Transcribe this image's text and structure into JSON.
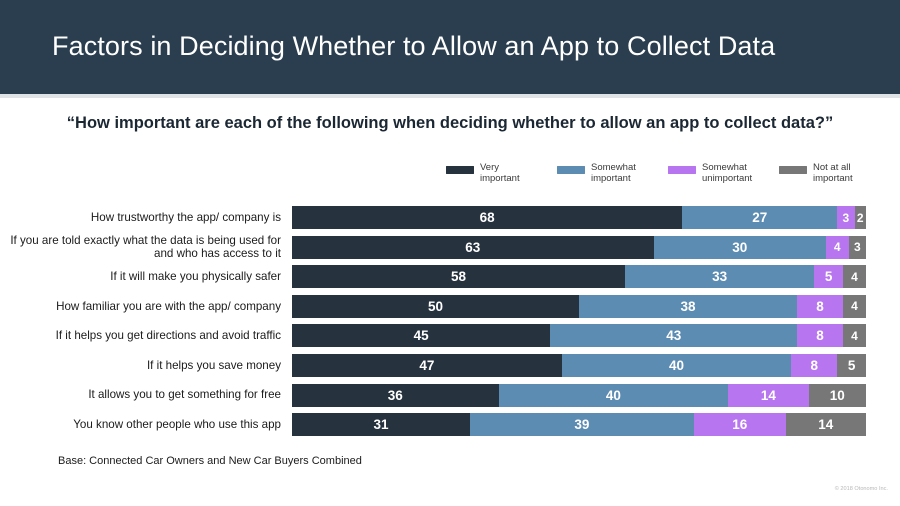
{
  "header": {
    "title": "Factors in Deciding Whether to Allow an App to Collect Data",
    "bar_color": "#2b3e4f"
  },
  "subtitle": "“How important are each of the following when deciding whether to allow an app to collect data?”",
  "legend": {
    "items": [
      {
        "label_line1": "Very",
        "label_line2": "important",
        "color": "#27323f"
      },
      {
        "label_line1": "Somewhat",
        "label_line2": "important",
        "color": "#5d8cb3"
      },
      {
        "label_line1": "Somewhat",
        "label_line2": "unimportant",
        "color": "#b776ef"
      },
      {
        "label_line1": "Not at all",
        "label_line2": "important",
        "color": "#777777"
      }
    ]
  },
  "footer": {
    "base_note": "Base: Connected Car Owners and New Car Buyers Combined",
    "copyright": "© 2018 Otonomo Inc."
  },
  "chart_data": {
    "type": "bar",
    "orientation": "horizontal",
    "stacked": true,
    "normalized_percent": true,
    "title": "Factors in Deciding Whether to Allow an App to Collect Data",
    "subtitle": "“How important are each of the following when deciding whether to allow an app to collect data?”",
    "xlabel": "",
    "ylabel": "",
    "xlim": [
      0,
      100
    ],
    "grid": false,
    "legend_position": "top-right",
    "value_unit": "percent",
    "categories": [
      "How trustworthy the app/ company is",
      "If you are told exactly what the data is being used for and who has access to it",
      "If it will make you physically safer",
      "How familiar you are with the app/ company",
      "If it helps you get directions and avoid traffic",
      "If it helps you save money",
      "It allows you to get something for free",
      "You know other people who use this app"
    ],
    "series": [
      {
        "name": "Very important",
        "color": "#27323f",
        "values": [
          68,
          63,
          58,
          50,
          45,
          47,
          36,
          31
        ]
      },
      {
        "name": "Somewhat important",
        "color": "#5d8cb3",
        "values": [
          27,
          30,
          33,
          38,
          43,
          40,
          40,
          39
        ]
      },
      {
        "name": "Somewhat unimportant",
        "color": "#b776ef",
        "values": [
          3,
          4,
          5,
          8,
          8,
          8,
          14,
          16
        ]
      },
      {
        "name": "Not at all important",
        "color": "#777777",
        "values": [
          2,
          3,
          4,
          4,
          4,
          5,
          10,
          14
        ]
      }
    ],
    "annotation": "Base: Connected Car Owners and New Car Buyers Combined"
  }
}
